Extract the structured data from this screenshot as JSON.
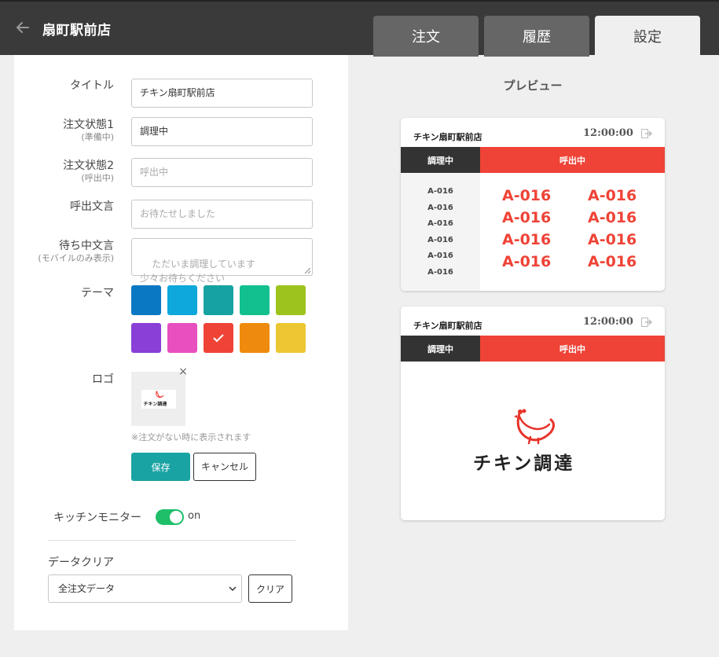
{
  "header": {
    "store_name": "扇町駅前店",
    "tabs": [
      {
        "label": "注文",
        "active": false
      },
      {
        "label": "履歴",
        "active": false
      },
      {
        "label": "設定",
        "active": true
      }
    ]
  },
  "settings": {
    "title": {
      "label": "タイトル",
      "value": "チキン扇町駅前店"
    },
    "status1": {
      "label": "注文状態1",
      "sub": "(準備中)",
      "value": "調理中"
    },
    "status2": {
      "label": "注文状態2",
      "sub": "(呼出中)",
      "placeholder": "呼出中"
    },
    "call_message": {
      "label": "呼出文言",
      "placeholder": "お待たせしました"
    },
    "waiting_message": {
      "label": "待ち中文言",
      "sub": "(モバイルのみ表示)",
      "placeholder": "ただいま調理しています\n少々お待ちください"
    },
    "theme": {
      "label": "テーマ",
      "colors": [
        "#0b78c4",
        "#0ea8dc",
        "#16a2a2",
        "#12c08e",
        "#9dc41c",
        "#8a3fd6",
        "#e84fbf",
        "#ef4337",
        "#ee8b0e",
        "#ecc733"
      ],
      "selected_index": 7
    },
    "logo": {
      "label": "ロゴ",
      "note": "※注文がない時に表示されます",
      "remove": "×",
      "thumb_text": "チキン調達"
    },
    "save_label": "保存",
    "cancel_label": "キャンセル",
    "kitchen_monitor": {
      "label": "キッチンモニター",
      "state": "on"
    },
    "data_clear": {
      "label": "データクリア",
      "selected": "全注文データ",
      "button": "クリア"
    }
  },
  "preview": {
    "title": "プレビュー",
    "store": "チキン扇町駅前店",
    "time": "12:00:00",
    "prep_label": "調理中",
    "call_label": "呼出中",
    "accent": "#ef4337",
    "prep_orders": [
      "A-016",
      "A-016",
      "A-016",
      "A-016",
      "A-016",
      "A-016"
    ],
    "call_orders": [
      "A-016",
      "A-016",
      "A-016",
      "A-016",
      "A-016",
      "A-016",
      "A-016",
      "A-016"
    ],
    "logo_text": "チキン調達"
  }
}
